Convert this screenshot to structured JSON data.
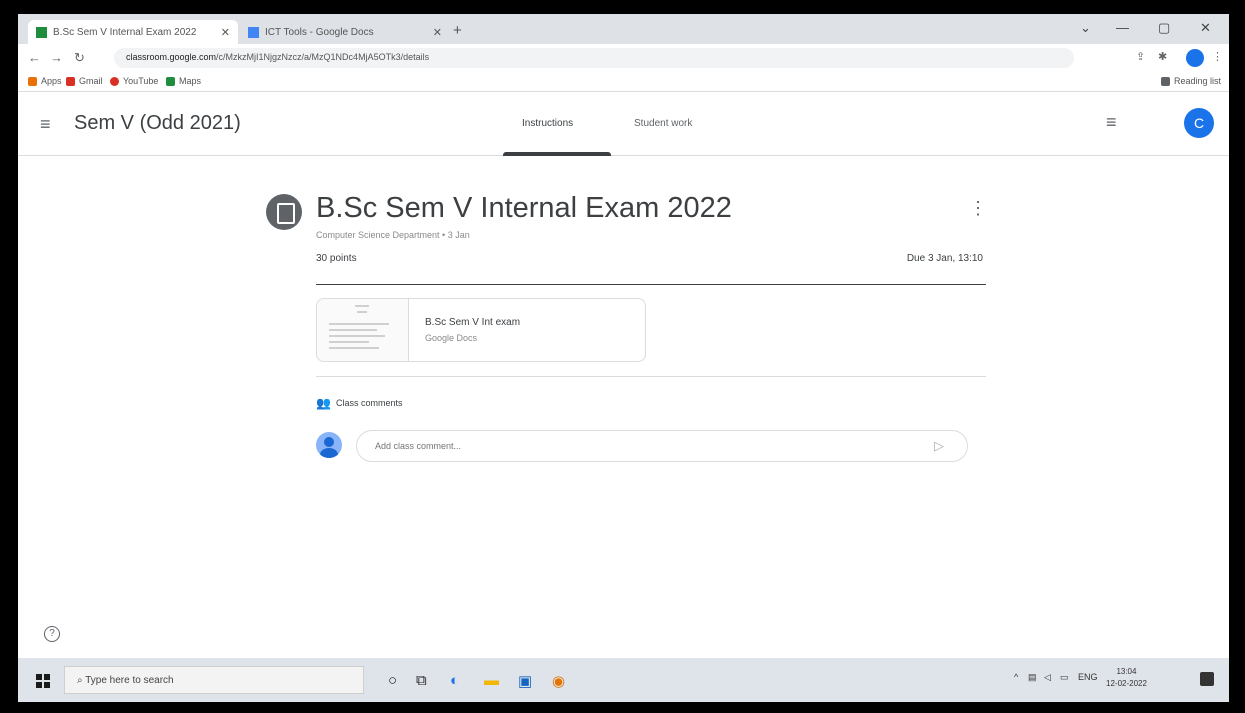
{
  "browser": {
    "tabs": [
      {
        "title": "B.Sc Sem V Internal Exam 2022",
        "favicon_color": "#1e8e3e"
      },
      {
        "title": "ICT Tools - Google Docs",
        "favicon_color": "#4285f4"
      }
    ],
    "new_tab": "+",
    "url_host": "classroom.google.com",
    "url_path": "/c/MzkzMjI1NjgzNzcz/a/MzQ1NDc4MjA5OTk3/details",
    "bookmarks": [
      {
        "label": "Apps",
        "color": "#e8710a"
      },
      {
        "label": "Gmail",
        "color": "#d93025"
      },
      {
        "label": "YouTube",
        "color": "#d93025"
      },
      {
        "label": "Maps",
        "color": "#1e8e3e"
      }
    ],
    "reading_list": "Reading list"
  },
  "classroom": {
    "course_title": "Sem V (Odd 2021)",
    "tabs": [
      {
        "label": "Instructions",
        "active": true
      },
      {
        "label": "Student work",
        "active": false
      }
    ],
    "account_initial": "C",
    "accent_color": "#1a73e8"
  },
  "assignment": {
    "title": "B.Sc Sem V Internal Exam 2022",
    "meta": "Computer Science Department • 3 Jan",
    "points": "30 points",
    "due": "Due 3 Jan, 13:10",
    "attachment": {
      "title": "B.Sc Sem V Int exam",
      "subtitle": "Google Docs"
    },
    "comments_label": "Class comments",
    "comment_placeholder": "Add class comment..."
  },
  "taskbar": {
    "search_placeholder": "Type here to search",
    "tray_language": "ENG",
    "time": "13:04",
    "date": "12-02-2022"
  }
}
